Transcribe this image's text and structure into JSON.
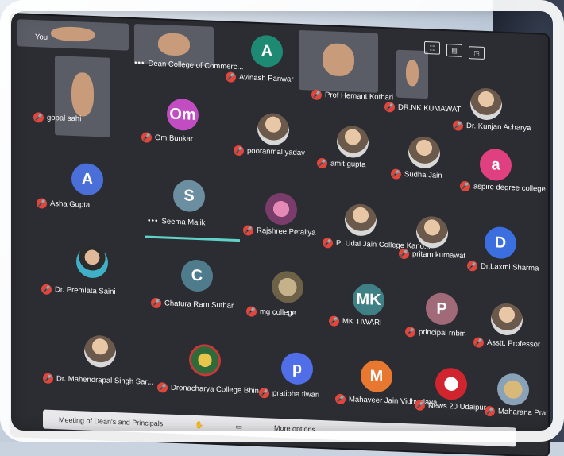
{
  "tiles": {
    "you": "You",
    "dean_commerce": "Dean College of Commerc...",
    "avinash": "Avinash Panwar",
    "prof_hemant": "Prof Hemant Kothari",
    "dr_kumawat": "DR.NK KUMAWAT",
    "kunjan": "Dr. Kunjan Acharya",
    "gopal": "gopal sahi",
    "om": "Om Bunkar",
    "pooranmal": "pooranmal yadav",
    "amit": "amit gupta",
    "sudha": "Sudha Jain",
    "aspire": "aspire degree college",
    "asha": "Asha Gupta",
    "seema": "Seema Malik",
    "rajshree": "Rajshree Petaliya",
    "pt_udai": "Pt Udai Jain College Kano...",
    "pritam": "pritam kumawat",
    "laxmi": "Dr.Laxmi Sharma",
    "premlata": "Dr. Premlata Saini",
    "chatura": "Chatura Ram Suthar",
    "mg": "mg college",
    "mk": "MK TIWARI",
    "principal": "principal rnbm",
    "asstt": "Asstt. Professor",
    "mahendrapal": "Dr. Mahendrapal Singh Sar...",
    "dronacharya": "Dronacharya College Bhin...",
    "pratibha": "pratibha tiwari",
    "mahaveer": "Mahaveer Jain Vidhyalaya ...",
    "news20": "News 20 Udaipur",
    "maharana": "Maharana Prat..."
  },
  "initials": {
    "avinash": "A",
    "om": "Om",
    "aspire": "a",
    "asha": "A",
    "seema": "S",
    "laxmi": "D",
    "chatura": "C",
    "mk": "MK",
    "principal": "P",
    "pratibha": "p",
    "mahaveer": "M"
  },
  "colors": {
    "avinash": "#1f8a73",
    "om": "#c24cc2",
    "aspire": "#e0407f",
    "asha": "#4a6fd8",
    "seema": "#6b8ea0",
    "laxmi": "#3b6fe0",
    "chatura": "#4f7c8c",
    "mk": "#3f7f86",
    "principal": "#a06a78",
    "pratibha": "#4f6ee8",
    "mahaveer": "#e8782f"
  },
  "bottom": {
    "title": "Meeting of Dean's and Principals",
    "more": "More options"
  }
}
